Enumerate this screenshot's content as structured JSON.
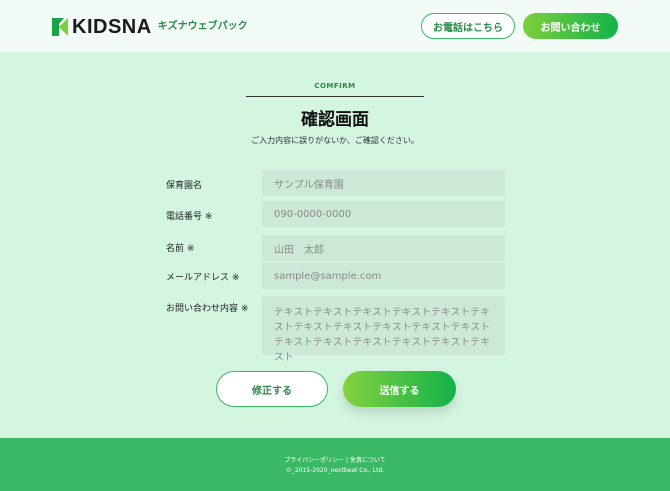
{
  "header": {
    "logo_text": "KIDSNA",
    "logo_sub": "キズナウェブパック",
    "tel_button": "お電話はこちら",
    "contact_button": "お問い合わせ"
  },
  "page": {
    "eyebrow": "COMFIRM",
    "title": "確認画面",
    "lead": "ご入力内容に誤りがないか、ご確認ください。"
  },
  "form": {
    "school_label": "保育園名",
    "school_value": "サンプル保育園",
    "phone_label": "電話番号 ※",
    "phone_value": "090-0000-0000",
    "name_label": "名前 ※",
    "name_value": "山田　太郎",
    "email_label": "メールアドレス ※",
    "email_value": "sample@sample.com",
    "message_label": "お問い合わせ内容 ※",
    "message_value": "テキストテキストテキストテキストテキストテキストテキストテキストテキストテキストテキストテキストテキストテキストテキストテキストテキスト"
  },
  "actions": {
    "fix_button": "修正する",
    "send_button": "送信する"
  },
  "footer": {
    "privacy": "プライバシーポリシー",
    "separator": "|",
    "terms": "免責について",
    "copyright": "©_2015-2020_nextbeat Co., Ltd."
  },
  "colors": {
    "brand_green": "#3bb866",
    "gradient_start": "#84d23e",
    "gradient_end": "#12b14a",
    "background": "#d4f5e0"
  }
}
